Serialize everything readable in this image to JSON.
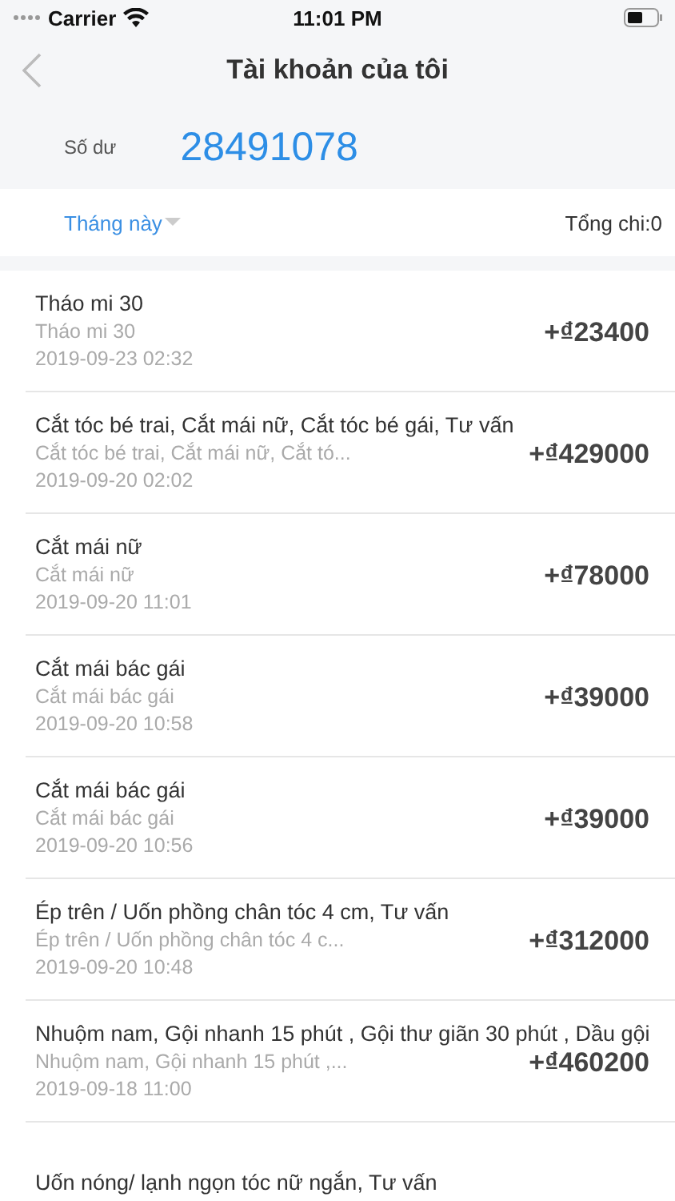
{
  "status_bar": {
    "carrier": "Carrier",
    "time": "11:01 PM"
  },
  "nav": {
    "title": "Tài khoản của tôi"
  },
  "balance": {
    "label": "Số dư",
    "value": "28491078"
  },
  "filter": {
    "period": "Tháng này",
    "total": "Tổng chi:0"
  },
  "transactions": [
    {
      "title": "Tháo mi 30",
      "subtitle": "Tháo mi 30",
      "date": "2019-09-23 02:32",
      "amount": "+₫23400"
    },
    {
      "title": "Cắt tóc bé trai, Cắt mái nữ, Cắt tóc bé gái, Tư vấn",
      "subtitle": "Cắt tóc bé trai, Cắt mái nữ, Cắt tó...",
      "date": "2019-09-20 02:02",
      "amount": "+₫429000"
    },
    {
      "title": "Cắt mái nữ",
      "subtitle": "Cắt mái nữ",
      "date": "2019-09-20 11:01",
      "amount": "+₫78000"
    },
    {
      "title": "Cắt mái bác gái",
      "subtitle": "Cắt mái bác gái",
      "date": "2019-09-20 10:58",
      "amount": "+₫39000"
    },
    {
      "title": "Cắt mái bác gái",
      "subtitle": "Cắt mái bác gái",
      "date": "2019-09-20 10:56",
      "amount": "+₫39000"
    },
    {
      "title": "Ép trên / Uốn phồng chân tóc 4 cm, Tư vấn",
      "subtitle": "Ép trên / Uốn phồng chân tóc 4 c...",
      "date": "2019-09-20 10:48",
      "amount": "+₫312000"
    },
    {
      "title": "Nhuộm nam, Gội nhanh 15 phút , Gội thư giãn 30 phút , Dầu gội",
      "subtitle": "Nhuộm nam, Gội nhanh 15 phút ,...",
      "date": "2019-09-18 11:00",
      "amount": "+₫460200"
    },
    {
      "title": "Uốn nóng/ lạnh ngọn tóc nữ ngắn, Tư vấn"
    }
  ]
}
